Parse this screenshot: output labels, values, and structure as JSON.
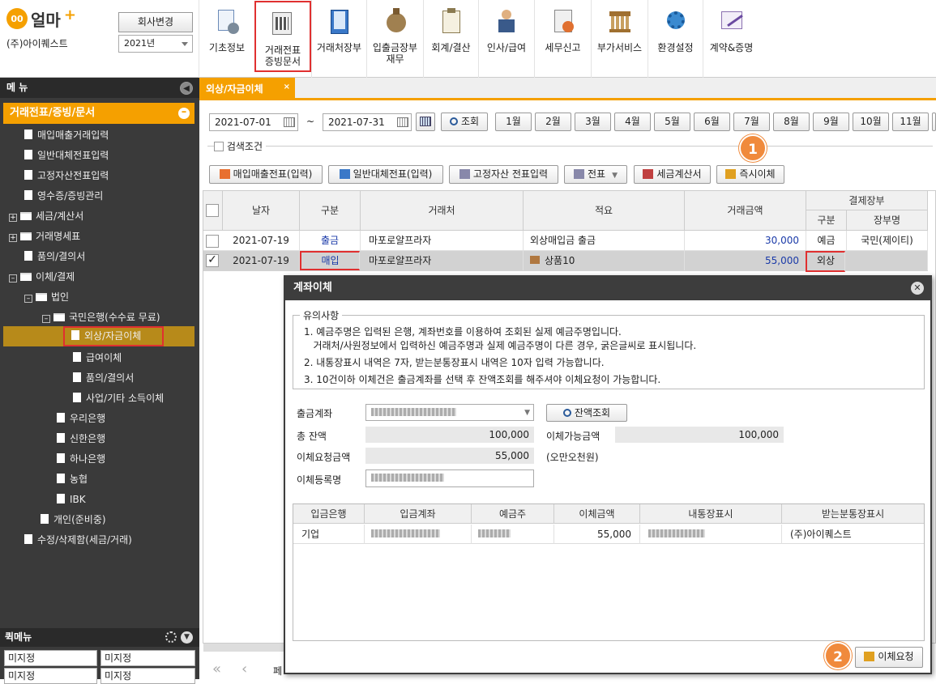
{
  "topbar": {
    "logo_text": "얼마",
    "logo_plus": "+",
    "company_name": "(주)아이퀘스트",
    "change_company": "회사변경",
    "year": "2021년",
    "items": [
      "기초정보",
      "거래전표\n증빙문서",
      "거래처장부",
      "입출금장부\n재무",
      "회계/결산",
      "인사/급여",
      "세무신고",
      "부가서비스",
      "환경설정",
      "계약&증명"
    ]
  },
  "sidebar": {
    "title": "메 뉴",
    "section": "거래전표/증빙/문서",
    "items": [
      "매입매출거래입력",
      "일반대체전표입력",
      "고정자산전표입력",
      "영수증/증빙관리",
      "세금/계산서",
      "거래명세표",
      "품의/결의서",
      "이체/결제",
      "법인",
      "국민은행(수수료 무료)",
      "외상/자금이체",
      "급여이체",
      "품의/결의서",
      "사업/기타 소득이체",
      "우리은행",
      "신한은행",
      "하나은행",
      "농협",
      "IBK",
      "개인(준비중)",
      "수정/삭제함(세금/거래)"
    ],
    "quick_menu": "퀵메뉴",
    "quick_buttons": [
      "미지정",
      "미지정",
      "미지정",
      "미지정"
    ]
  },
  "tab": {
    "label": "외상/자금이체",
    "close": "×"
  },
  "filter": {
    "date_from": "2021-07-01",
    "tilde": "~",
    "date_to": "2021-07-31",
    "search": "조회",
    "months": [
      "1월",
      "2월",
      "3월",
      "4월",
      "5월",
      "6월",
      "7월",
      "8월",
      "9월",
      "10월",
      "11월"
    ],
    "search_cond": "검색조건"
  },
  "toolbar": {
    "buttons": [
      "매입매출전표(입력)",
      "일반대체전표(입력)",
      "고정자산 전표입력",
      "전표",
      "세금계산서",
      "즉시이체"
    ]
  },
  "badges": [
    "1",
    "2"
  ],
  "grid": {
    "headers": [
      "날자",
      "구분",
      "거래처",
      "적요",
      "거래금액",
      "결제장부",
      "구분",
      "장부명"
    ],
    "rows": [
      {
        "date": "2021-07-19",
        "type": "출금",
        "partner": "마포로얄프라자",
        "memo": "외상매입금 출금",
        "amount": "30,000",
        "pay_type": "예금",
        "book": "국민(제이티)"
      },
      {
        "date": "2021-07-19",
        "type": "매입",
        "partner": "마포로얄프라자",
        "memo": "상품10",
        "amount": "55,000",
        "pay_type": "외상",
        "book": ""
      }
    ],
    "footer_prefix": "페"
  },
  "dialog": {
    "title": "계좌이체",
    "notice_title": "유의사항",
    "notices": [
      "1. 예금주명은 입력된 은행, 계좌번호를 이용하여 조회된 실제 예금주명입니다.",
      "   거래처/사원정보에서 입력하신 예금주명과 실제 예금주명이 다른 경우, 굵은글씨로 표시됩니다.",
      "2. 내통장표시 내역은 7자, 받는분통장표시 내역은 10자 입력 가능합니다.",
      "3. 10건이하 이체건은 출금계좌를 선택 후 잔액조회를 해주셔야 이체요청이 가능합니다."
    ],
    "labels": {
      "account": "출금계좌",
      "total_balance": "총 잔액",
      "request_amount": "이체요청금액",
      "reg_name": "이체등록명",
      "available": "이체가능금액"
    },
    "balance_btn": "잔액조회",
    "total_balance": "100,000",
    "available": "100,000",
    "request_amount": "55,000",
    "amount_korean": "(오만오천원)",
    "table_headers": [
      "입금은행",
      "입금계좌",
      "예금주",
      "이체금액",
      "내통장표시",
      "받는분통장표시"
    ],
    "table_row": {
      "bank": "기업",
      "amount": "55,000",
      "receiver_display": "(주)아이퀘스트"
    },
    "request_btn": "이체요청"
  },
  "colors": {
    "accent": "#f5a000",
    "highlight": "#e03030",
    "badge": "#f08a3c",
    "sidebar": "#3a3a3a"
  }
}
